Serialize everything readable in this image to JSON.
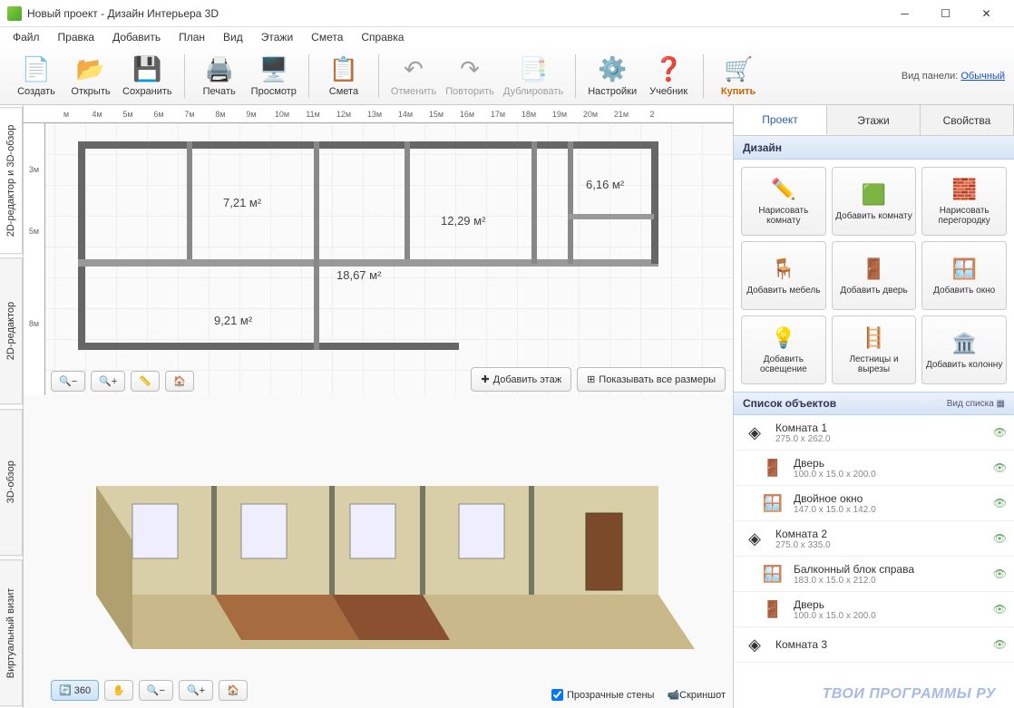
{
  "window": {
    "title": "Новый проект - Дизайн Интерьера 3D"
  },
  "menu": {
    "file": "Файл",
    "edit": "Правка",
    "add": "Добавить",
    "plan": "План",
    "view": "Вид",
    "floors": "Этажи",
    "estimate": "Смета",
    "help": "Справка"
  },
  "panel_mode": {
    "label": "Вид панели:",
    "value": "Обычный"
  },
  "toolbar": {
    "create": "Создать",
    "open": "Открыть",
    "save": "Сохранить",
    "print": "Печать",
    "preview": "Просмотр",
    "estimate": "Смета",
    "undo": "Отменить",
    "redo": "Повторить",
    "duplicate": "Дублировать",
    "settings": "Настройки",
    "tutorial": "Учебник",
    "buy": "Купить"
  },
  "vtabs": {
    "t1": "2D-редактор и 3D-обзор",
    "t2": "2D-редактор",
    "t3": "3D-обзор",
    "t4": "Виртуальный визит"
  },
  "ruler_top": [
    "м",
    "4м",
    "5м",
    "6м",
    "7м",
    "8м",
    "9м",
    "10м",
    "11м",
    "12м",
    "13м",
    "14м",
    "15м",
    "16м",
    "17м",
    "18м",
    "19м",
    "20м",
    "21м",
    "2"
  ],
  "ruler_left": [
    "",
    "3м",
    "",
    "5м",
    "",
    "",
    "8м"
  ],
  "rooms": {
    "r1": "7,21 м²",
    "r2": "18,67 м²",
    "r3": "12,29 м²",
    "r4": "6,16 м²",
    "r5": "9,21 м²"
  },
  "plan_buttons": {
    "add_floor": "Добавить этаж",
    "show_dims": "Показывать все размеры"
  },
  "view3d_buttons": {
    "transparent": "Прозрачные стены",
    "screenshot": "Скриншот"
  },
  "side_tabs": {
    "project": "Проект",
    "floors": "Этажи",
    "props": "Свойства"
  },
  "section_design": "Дизайн",
  "tools": {
    "draw_room": "Нарисовать комнату",
    "add_room": "Добавить комнату",
    "draw_wall": "Нарисовать перегородку",
    "add_furn": "Добавить мебель",
    "add_door": "Добавить дверь",
    "add_window": "Добавить окно",
    "add_light": "Добавить освещение",
    "stairs": "Лестницы и вырезы",
    "add_column": "Добавить колонну"
  },
  "objlist_head": "Список объектов",
  "objlist_mode": "Вид списка",
  "objects": [
    {
      "name": "Комната 1",
      "dim": "275.0 x 262.0",
      "type": "room"
    },
    {
      "name": "Дверь",
      "dim": "100.0 x 15.0 x 200.0",
      "type": "door",
      "indent": true
    },
    {
      "name": "Двойное окно",
      "dim": "147.0 x 15.0 x 142.0",
      "type": "window",
      "indent": true
    },
    {
      "name": "Комната 2",
      "dim": "275.0 x 335.0",
      "type": "room"
    },
    {
      "name": "Балконный блок справа",
      "dim": "183.0 x 15.0 x 212.0",
      "type": "window",
      "indent": true
    },
    {
      "name": "Дверь",
      "dim": "100.0 x 15.0 x 200.0",
      "type": "door",
      "indent": true
    },
    {
      "name": "Комната 3",
      "dim": "",
      "type": "room"
    }
  ],
  "watermark": "ТВОИ ПРОГРАММЫ РУ"
}
